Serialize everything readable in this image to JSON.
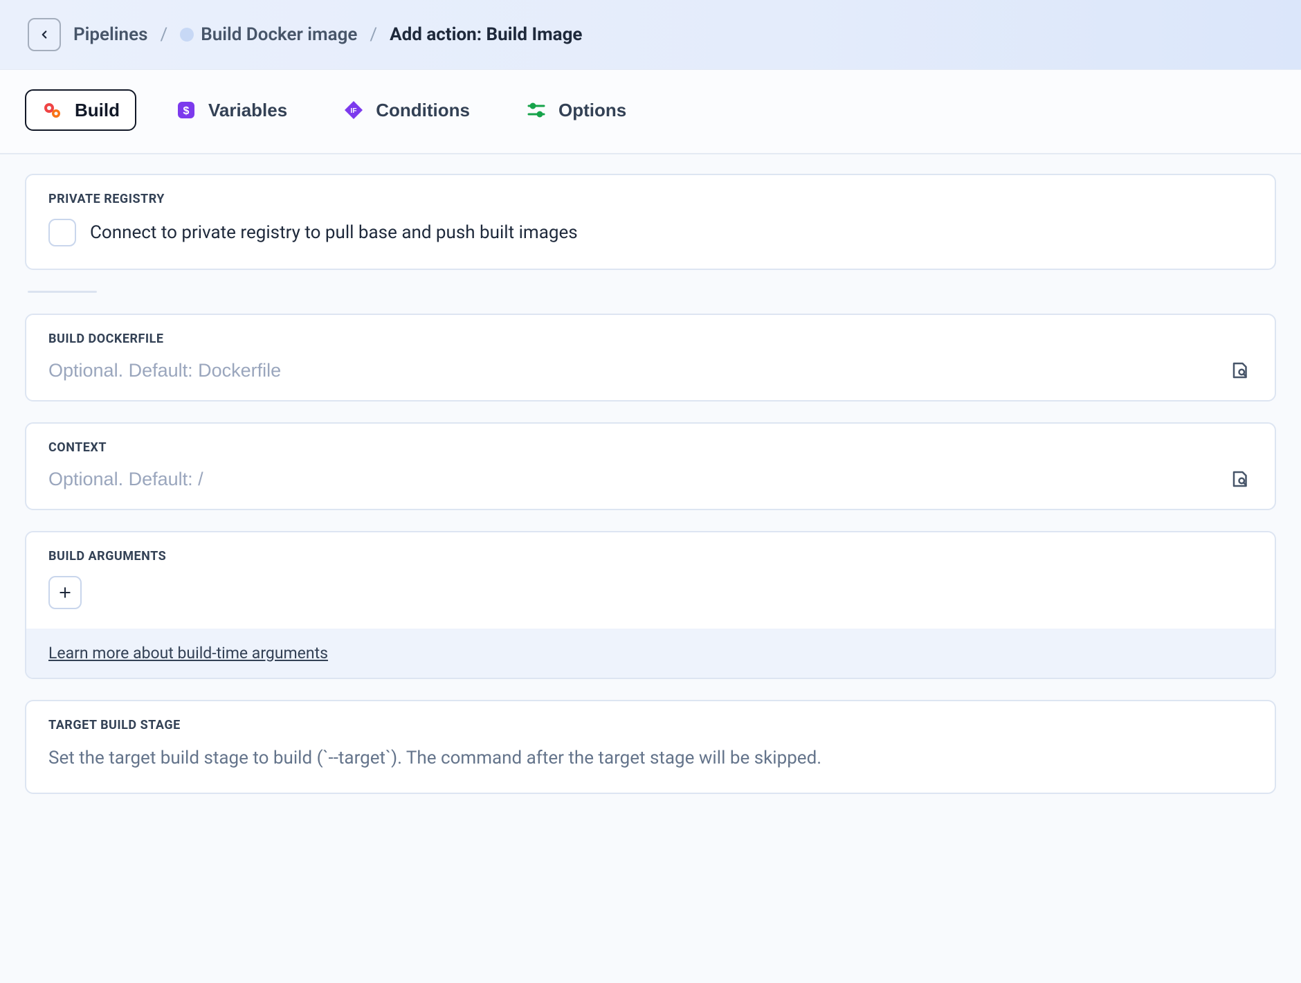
{
  "breadcrumb": {
    "root": "Pipelines",
    "pipeline": "Build Docker image",
    "current": "Add action: Build Image"
  },
  "tabs": {
    "build": "Build",
    "variables": "Variables",
    "conditions": "Conditions",
    "options": "Options"
  },
  "privateRegistry": {
    "title": "PRIVATE REGISTRY",
    "label": "Connect to private registry to pull base and push built images"
  },
  "dockerfile": {
    "title": "BUILD DOCKERFILE",
    "placeholder": "Optional. Default: Dockerfile"
  },
  "context": {
    "title": "CONTEXT",
    "placeholder": "Optional. Default: /"
  },
  "buildArgs": {
    "title": "BUILD ARGUMENTS",
    "learnMore": "Learn more about build-time arguments"
  },
  "targetStage": {
    "title": "TARGET BUILD STAGE",
    "description": "Set the target build stage to build (`--target`). The command after the target stage will be skipped."
  }
}
